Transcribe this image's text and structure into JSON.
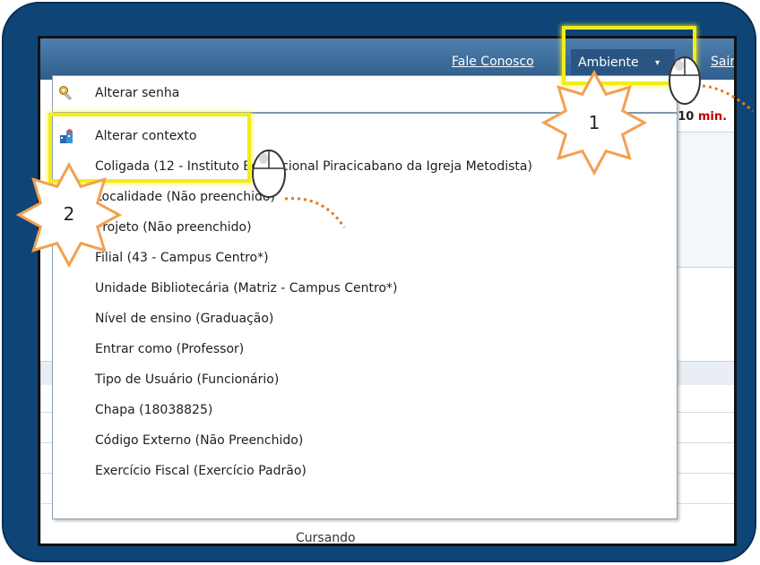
{
  "header": {
    "links": [
      {
        "label": "Fale Conosco"
      },
      {
        "label": "Ambiente"
      },
      {
        "label": "Sair"
      }
    ]
  },
  "background": {
    "timer_value": ":10",
    "timer_unit": "min.",
    "status_text": "Cursando"
  },
  "menu": {
    "items": [
      {
        "label": "Alterar senha",
        "icon": "key-icon"
      },
      {
        "label": "Alterar contexto",
        "icon": "context-icon"
      },
      {
        "label": "Coligada (12 - Instituto Educacional Piracicabano da Igreja Metodista)"
      },
      {
        "label": "Localidade (Não preenchido)"
      },
      {
        "label": "Projeto (Não preenchido)"
      },
      {
        "label": "Filial (43 - Campus Centro*)"
      },
      {
        "label": "Unidade Bibliotecária (Matriz - Campus Centro*)"
      },
      {
        "label": "Nível de ensino (Graduação)"
      },
      {
        "label": "Entrar como (Professor)"
      },
      {
        "label": "Tipo de Usuário (Funcionário)"
      },
      {
        "label": "Chapa (18038825)"
      },
      {
        "label": "Código Externo (Não Preenchido)"
      },
      {
        "label": "Exercício Fiscal (Exercício Padrão)"
      }
    ]
  },
  "annotations": {
    "step_1": "1",
    "step_2": "2",
    "highlight_color": "#f2ec1a",
    "badge_color": "#f3a04f",
    "frame_color": "#0f4576"
  }
}
